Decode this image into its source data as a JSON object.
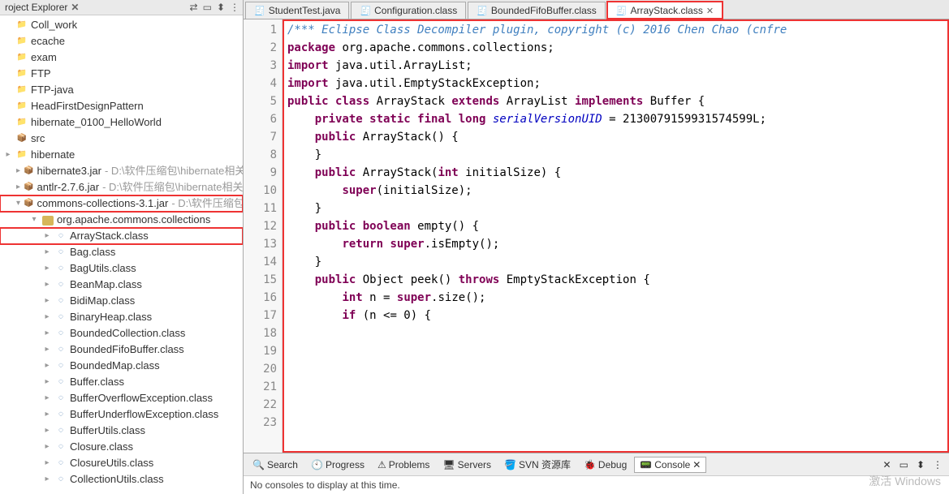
{
  "explorer": {
    "title": "roject Explorer",
    "close_glyph": "✕",
    "toolbar": [
      "⇄",
      "▭",
      "⬍",
      "⋮"
    ],
    "nodes": [
      {
        "d": 0,
        "t": "Coll_work",
        "k": "folder",
        "tw": ""
      },
      {
        "d": 0,
        "t": "ecache",
        "k": "folder",
        "tw": ""
      },
      {
        "d": 0,
        "t": "exam",
        "k": "folder",
        "tw": ""
      },
      {
        "d": 0,
        "t": "FTP",
        "k": "folder",
        "tw": ""
      },
      {
        "d": 0,
        "t": "FTP-java",
        "k": "folder",
        "tw": ""
      },
      {
        "d": 0,
        "t": "HeadFirstDesignPattern",
        "k": "folder",
        "tw": ""
      },
      {
        "d": 0,
        "t": "hibernate_0100_HelloWorld",
        "k": "folder",
        "tw": ""
      },
      {
        "d": 0,
        "t": "src",
        "k": "jar",
        "tw": ""
      },
      {
        "d": 0,
        "t": "hibernate",
        "k": "folder",
        "tw": "▸"
      },
      {
        "d": 1,
        "t": "hibernate3.jar",
        "k": "jar",
        "tw": "▸",
        "suf": " - D:\\软件压缩包\\hibernate相关"
      },
      {
        "d": 1,
        "t": "antlr-2.7.6.jar",
        "k": "jar",
        "tw": "▸",
        "suf": " - D:\\软件压缩包\\hibernate相关"
      },
      {
        "d": 1,
        "t": "commons-collections-3.1.jar",
        "k": "jar",
        "tw": "▾",
        "suf": " - D:\\软件压缩包",
        "hl": true
      },
      {
        "d": 2,
        "t": "org.apache.commons.collections",
        "k": "pkg",
        "tw": "▾"
      },
      {
        "d": 3,
        "t": "ArrayStack.class",
        "k": "cls",
        "tw": "▸",
        "hl": true
      },
      {
        "d": 3,
        "t": "Bag.class",
        "k": "cls",
        "tw": "▸"
      },
      {
        "d": 3,
        "t": "BagUtils.class",
        "k": "cls",
        "tw": "▸"
      },
      {
        "d": 3,
        "t": "BeanMap.class",
        "k": "cls",
        "tw": "▸"
      },
      {
        "d": 3,
        "t": "BidiMap.class",
        "k": "cls",
        "tw": "▸"
      },
      {
        "d": 3,
        "t": "BinaryHeap.class",
        "k": "cls",
        "tw": "▸"
      },
      {
        "d": 3,
        "t": "BoundedCollection.class",
        "k": "cls",
        "tw": "▸"
      },
      {
        "d": 3,
        "t": "BoundedFifoBuffer.class",
        "k": "cls",
        "tw": "▸"
      },
      {
        "d": 3,
        "t": "BoundedMap.class",
        "k": "cls",
        "tw": "▸"
      },
      {
        "d": 3,
        "t": "Buffer.class",
        "k": "cls",
        "tw": "▸"
      },
      {
        "d": 3,
        "t": "BufferOverflowException.class",
        "k": "cls",
        "tw": "▸"
      },
      {
        "d": 3,
        "t": "BufferUnderflowException.class",
        "k": "cls",
        "tw": "▸"
      },
      {
        "d": 3,
        "t": "BufferUtils.class",
        "k": "cls",
        "tw": "▸"
      },
      {
        "d": 3,
        "t": "Closure.class",
        "k": "cls",
        "tw": "▸"
      },
      {
        "d": 3,
        "t": "ClosureUtils.class",
        "k": "cls",
        "tw": "▸"
      },
      {
        "d": 3,
        "t": "CollectionUtils.class",
        "k": "cls",
        "tw": "▸"
      }
    ]
  },
  "tabs": [
    {
      "label": "StudentTest.java",
      "active": false
    },
    {
      "label": "Configuration.class",
      "active": false
    },
    {
      "label": "BoundedFifoBuffer.class",
      "active": false
    },
    {
      "label": "ArrayStack.class",
      "active": true,
      "hl": true
    }
  ],
  "gutter": [
    "1",
    "2",
    "3",
    "4",
    "5",
    "6",
    "7",
    "8",
    "9",
    "10",
    "11",
    "12",
    "13",
    "14",
    "15",
    "16",
    "17",
    "18",
    "19",
    "20",
    "21",
    "22",
    "23"
  ],
  "code_lines": [
    [
      {
        "c": "cm",
        "t": "/*** Eclipse Class Decompiler plugin, copyright (c) 2016 Chen Chao (cnfre"
      }
    ],
    [
      {
        "c": "kw",
        "t": "package"
      },
      {
        "c": "nm",
        "t": " org.apache.commons.collections;"
      }
    ],
    [
      {
        "c": "nm",
        "t": ""
      }
    ],
    [
      {
        "c": "kw",
        "t": "import"
      },
      {
        "c": "nm",
        "t": " java.util.ArrayList;"
      }
    ],
    [
      {
        "c": "kw",
        "t": "import"
      },
      {
        "c": "nm",
        "t": " java.util.EmptyStackException;"
      }
    ],
    [
      {
        "c": "nm",
        "t": ""
      }
    ],
    [
      {
        "c": "kw",
        "t": "public class"
      },
      {
        "c": "nm",
        "t": " ArrayStack "
      },
      {
        "c": "kw",
        "t": "extends"
      },
      {
        "c": "nm",
        "t": " ArrayList "
      },
      {
        "c": "kw",
        "t": "implements"
      },
      {
        "c": "nm",
        "t": " Buffer {"
      }
    ],
    [
      {
        "c": "nm",
        "t": "    "
      },
      {
        "c": "kw",
        "t": "private static final long"
      },
      {
        "c": "nm",
        "t": " "
      },
      {
        "c": "id",
        "t": "serialVersionUID"
      },
      {
        "c": "nm",
        "t": " = 2130079159931574599L;"
      }
    ],
    [
      {
        "c": "nm",
        "t": ""
      }
    ],
    [
      {
        "c": "nm",
        "t": "    "
      },
      {
        "c": "kw",
        "t": "public"
      },
      {
        "c": "nm",
        "t": " ArrayStack() {"
      }
    ],
    [
      {
        "c": "nm",
        "t": "    }"
      }
    ],
    [
      {
        "c": "nm",
        "t": ""
      }
    ],
    [
      {
        "c": "nm",
        "t": "    "
      },
      {
        "c": "kw",
        "t": "public"
      },
      {
        "c": "nm",
        "t": " ArrayStack("
      },
      {
        "c": "kw",
        "t": "int"
      },
      {
        "c": "nm",
        "t": " initialSize) {"
      }
    ],
    [
      {
        "c": "nm",
        "t": "        "
      },
      {
        "c": "kw",
        "t": "super"
      },
      {
        "c": "nm",
        "t": "(initialSize);"
      }
    ],
    [
      {
        "c": "nm",
        "t": "    }"
      }
    ],
    [
      {
        "c": "nm",
        "t": ""
      }
    ],
    [
      {
        "c": "nm",
        "t": "    "
      },
      {
        "c": "kw",
        "t": "public boolean"
      },
      {
        "c": "nm",
        "t": " empty() {"
      }
    ],
    [
      {
        "c": "nm",
        "t": "        "
      },
      {
        "c": "kw",
        "t": "return super"
      },
      {
        "c": "nm",
        "t": ".isEmpty();"
      }
    ],
    [
      {
        "c": "nm",
        "t": "    }"
      }
    ],
    [
      {
        "c": "nm",
        "t": ""
      }
    ],
    [
      {
        "c": "nm",
        "t": "    "
      },
      {
        "c": "kw",
        "t": "public"
      },
      {
        "c": "nm",
        "t": " Object peek() "
      },
      {
        "c": "kw",
        "t": "throws"
      },
      {
        "c": "nm",
        "t": " EmptyStackException {"
      }
    ],
    [
      {
        "c": "nm",
        "t": "        "
      },
      {
        "c": "kw",
        "t": "int"
      },
      {
        "c": "nm",
        "t": " n = "
      },
      {
        "c": "kw",
        "t": "super"
      },
      {
        "c": "nm",
        "t": ".size();"
      }
    ],
    [
      {
        "c": "nm",
        "t": "        "
      },
      {
        "c": "kw",
        "t": "if"
      },
      {
        "c": "nm",
        "t": " (n <= 0) {"
      }
    ]
  ],
  "bottom_tabs": [
    {
      "icon": "🔍",
      "label": "Search"
    },
    {
      "icon": "🕙",
      "label": "Progress"
    },
    {
      "icon": "⚠",
      "label": "Problems"
    },
    {
      "icon": "🖥",
      "label": "Servers"
    },
    {
      "icon": "🪣",
      "label": "SVN 资源库"
    },
    {
      "icon": "🐞",
      "label": "Debug"
    },
    {
      "icon": "📟",
      "label": "Console",
      "active": true
    }
  ],
  "bottom_toolbar": [
    "✕",
    "▭",
    "⬍",
    "⋮"
  ],
  "console_msg": "No consoles to display at this time.",
  "watermark": "激活 Windows"
}
